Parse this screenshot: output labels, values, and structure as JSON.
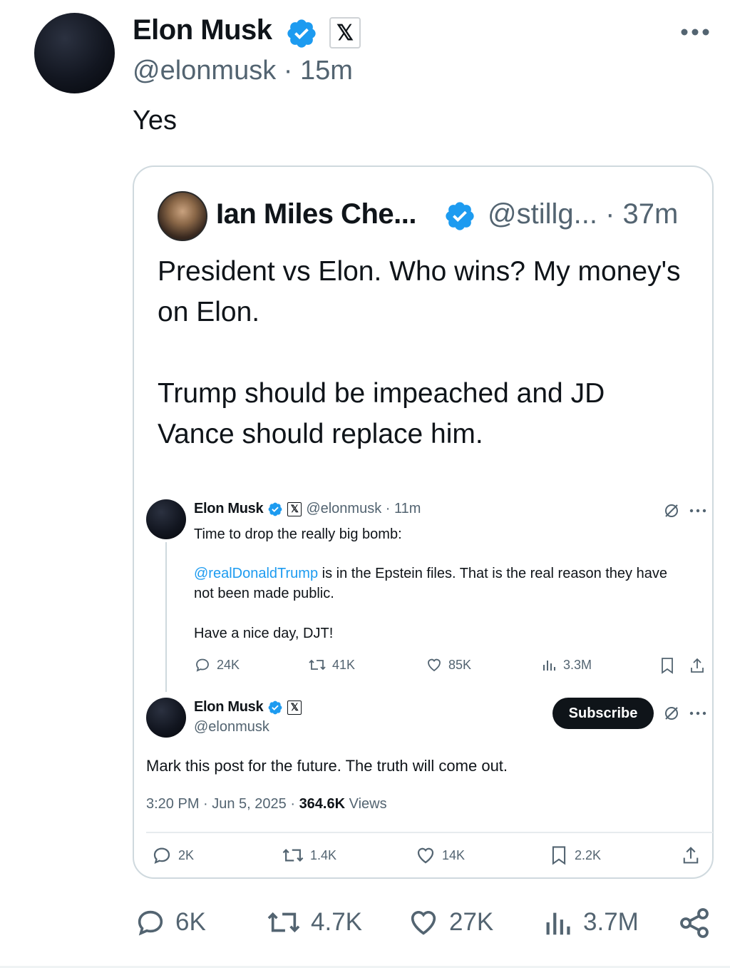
{
  "tweet": {
    "author_name": "Elon Musk",
    "handle_time": "@elonmusk · 15m",
    "text": "Yes",
    "x_badge": "𝕏",
    "icons": [
      "verified-icon",
      "x-affiliate-icon",
      "more-icon"
    ],
    "actions": {
      "replies": "6K",
      "reposts": "4.7K",
      "likes": "27K",
      "views": "3.7M"
    }
  },
  "quote": {
    "author_name": "Ian Miles Che...",
    "handle_time": "@stillg... · 37m",
    "text_p1": "President vs Elon. Who wins? My money's on Elon.",
    "text_p2": "Trump should be impeached and JD Vance should replace him.",
    "embedded": {
      "post1": {
        "author_name": "Elon Musk",
        "handle_time": "@elonmusk · 11m",
        "line1": "Time to drop the really big bomb:",
        "mention": "@realDonaldTrump",
        "line2_rest": " is in the Epstein files. That is the real reason they have",
        "line3": "not been made public.",
        "line4": "Have a nice day, DJT!",
        "replies": "24K",
        "reposts": "41K",
        "likes": "85K",
        "views": "3.3M"
      },
      "post2": {
        "author_name": "Elon Musk",
        "handle": "@elonmusk",
        "subscribe_label": "Subscribe",
        "text": "Mark this post for the future. The truth will come out.",
        "meta_prefix": "3:20 PM · Jun 5, 2025 · ",
        "views_count": "364.6K",
        "views_label": " Views",
        "replies": "2K",
        "reposts": "1.4K",
        "likes": "14K",
        "bookmarks": "2.2K"
      }
    }
  },
  "colors": {
    "verified": "#1d9bf0",
    "text": "#0f1419",
    "secondary": "#536471",
    "border": "#cfd9de"
  }
}
